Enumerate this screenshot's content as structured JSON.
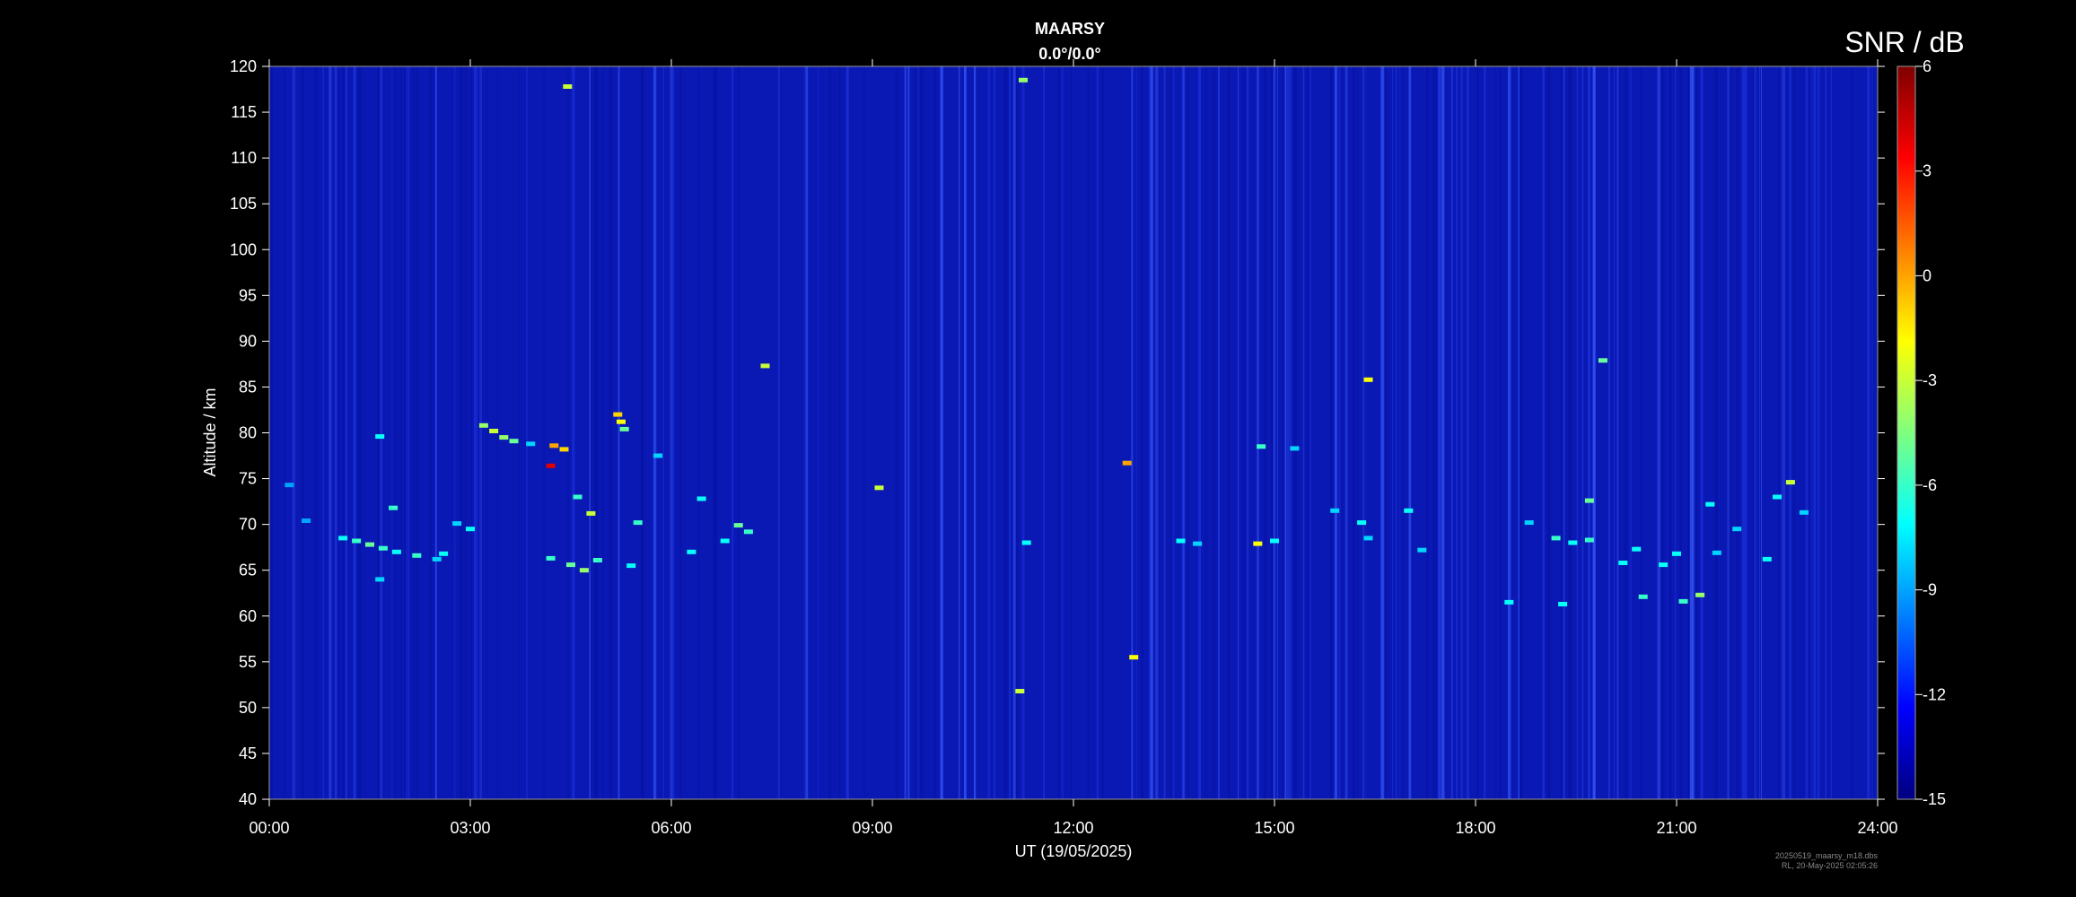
{
  "chart_data": {
    "type": "heatmap",
    "title": "MAARSY",
    "subtitle": "0.0°/0.0°",
    "xlabel": "UT (19/05/2025)",
    "ylabel": "Altitude / km",
    "x_ticks": [
      "00:00",
      "03:00",
      "06:00",
      "09:00",
      "12:00",
      "15:00",
      "18:00",
      "21:00",
      "24:00"
    ],
    "xlim_hours": [
      0,
      24
    ],
    "ylim": [
      40,
      120
    ],
    "y_ticks": [
      40,
      45,
      50,
      55,
      60,
      65,
      70,
      75,
      80,
      85,
      90,
      95,
      100,
      105,
      110,
      115,
      120
    ],
    "colorbar": {
      "title": "SNR / dB",
      "range": [
        -15,
        6
      ],
      "ticks": [
        -15,
        -12,
        -9,
        -6,
        -3,
        0,
        3,
        6
      ],
      "colormap": [
        "#00007f",
        "#0000ff",
        "#007fff",
        "#00ffff",
        "#7fff7f",
        "#ffff00",
        "#ff7f00",
        "#ff0000",
        "#7f0000"
      ]
    },
    "background_snr": -14.5,
    "echoes": [
      {
        "t": 1.1,
        "alt": 68.5,
        "snr": -7
      },
      {
        "t": 1.3,
        "alt": 68.2,
        "snr": -6
      },
      {
        "t": 1.5,
        "alt": 67.8,
        "snr": -5
      },
      {
        "t": 1.7,
        "alt": 67.4,
        "snr": -6
      },
      {
        "t": 1.9,
        "alt": 67.0,
        "snr": -7
      },
      {
        "t": 2.2,
        "alt": 66.6,
        "snr": -6
      },
      {
        "t": 2.5,
        "alt": 66.2,
        "snr": -8
      },
      {
        "t": 2.6,
        "alt": 66.8,
        "snr": -7
      },
      {
        "t": 1.85,
        "alt": 71.8,
        "snr": -6
      },
      {
        "t": 1.65,
        "alt": 64.0,
        "snr": -8
      },
      {
        "t": 1.65,
        "alt": 79.6,
        "snr": -7
      },
      {
        "t": 2.8,
        "alt": 70.1,
        "snr": -8
      },
      {
        "t": 3.0,
        "alt": 69.5,
        "snr": -7
      },
      {
        "t": 0.3,
        "alt": 74.3,
        "snr": -9
      },
      {
        "t": 0.55,
        "alt": 70.4,
        "snr": -9
      },
      {
        "t": 3.2,
        "alt": 80.8,
        "snr": -4
      },
      {
        "t": 3.35,
        "alt": 80.2,
        "snr": -3
      },
      {
        "t": 3.5,
        "alt": 79.5,
        "snr": -4
      },
      {
        "t": 3.65,
        "alt": 79.1,
        "snr": -5
      },
      {
        "t": 3.9,
        "alt": 78.8,
        "snr": -8
      },
      {
        "t": 4.25,
        "alt": 78.6,
        "snr": 0
      },
      {
        "t": 4.4,
        "alt": 78.2,
        "snr": -1
      },
      {
        "t": 4.2,
        "alt": 76.4,
        "snr": 4
      },
      {
        "t": 4.6,
        "alt": 73.0,
        "snr": -6
      },
      {
        "t": 4.8,
        "alt": 71.2,
        "snr": -3
      },
      {
        "t": 4.2,
        "alt": 66.3,
        "snr": -6
      },
      {
        "t": 4.5,
        "alt": 65.6,
        "snr": -5
      },
      {
        "t": 4.7,
        "alt": 65.0,
        "snr": -4
      },
      {
        "t": 4.9,
        "alt": 66.1,
        "snr": -6
      },
      {
        "t": 5.2,
        "alt": 82.0,
        "snr": -1
      },
      {
        "t": 5.25,
        "alt": 81.2,
        "snr": -2
      },
      {
        "t": 5.3,
        "alt": 80.4,
        "snr": -5
      },
      {
        "t": 5.5,
        "alt": 70.2,
        "snr": -6
      },
      {
        "t": 5.4,
        "alt": 65.5,
        "snr": -7
      },
      {
        "t": 5.8,
        "alt": 77.5,
        "snr": -8
      },
      {
        "t": 6.3,
        "alt": 67.0,
        "snr": -7
      },
      {
        "t": 6.45,
        "alt": 72.8,
        "snr": -7
      },
      {
        "t": 6.8,
        "alt": 68.2,
        "snr": -7
      },
      {
        "t": 7.0,
        "alt": 69.9,
        "snr": -5
      },
      {
        "t": 7.15,
        "alt": 69.2,
        "snr": -6
      },
      {
        "t": 7.4,
        "alt": 87.3,
        "snr": -3
      },
      {
        "t": 9.1,
        "alt": 74.0,
        "snr": -3
      },
      {
        "t": 11.3,
        "alt": 68.0,
        "snr": -7
      },
      {
        "t": 12.8,
        "alt": 76.7,
        "snr": 0
      },
      {
        "t": 13.6,
        "alt": 68.2,
        "snr": -7
      },
      {
        "t": 13.85,
        "alt": 67.9,
        "snr": -8
      },
      {
        "t": 14.8,
        "alt": 78.5,
        "snr": -6
      },
      {
        "t": 14.75,
        "alt": 67.9,
        "snr": -2
      },
      {
        "t": 15.0,
        "alt": 68.2,
        "snr": -7
      },
      {
        "t": 15.3,
        "alt": 78.3,
        "snr": -8
      },
      {
        "t": 15.9,
        "alt": 71.5,
        "snr": -8
      },
      {
        "t": 16.3,
        "alt": 70.2,
        "snr": -7
      },
      {
        "t": 16.4,
        "alt": 68.5,
        "snr": -8
      },
      {
        "t": 16.4,
        "alt": 85.8,
        "snr": -2
      },
      {
        "t": 17.0,
        "alt": 71.5,
        "snr": -7
      },
      {
        "t": 17.2,
        "alt": 67.2,
        "snr": -8
      },
      {
        "t": 18.5,
        "alt": 61.5,
        "snr": -7
      },
      {
        "t": 18.8,
        "alt": 70.2,
        "snr": -8
      },
      {
        "t": 19.2,
        "alt": 68.5,
        "snr": -6
      },
      {
        "t": 19.45,
        "alt": 68.0,
        "snr": -7
      },
      {
        "t": 19.7,
        "alt": 68.3,
        "snr": -6
      },
      {
        "t": 19.3,
        "alt": 61.3,
        "snr": -7
      },
      {
        "t": 19.7,
        "alt": 72.6,
        "snr": -5
      },
      {
        "t": 19.9,
        "alt": 87.9,
        "snr": -5
      },
      {
        "t": 20.2,
        "alt": 65.8,
        "snr": -7
      },
      {
        "t": 20.4,
        "alt": 67.3,
        "snr": -7
      },
      {
        "t": 20.5,
        "alt": 62.1,
        "snr": -6
      },
      {
        "t": 20.8,
        "alt": 65.6,
        "snr": -7
      },
      {
        "t": 21.0,
        "alt": 66.8,
        "snr": -7
      },
      {
        "t": 21.1,
        "alt": 61.6,
        "snr": -6
      },
      {
        "t": 21.35,
        "alt": 62.3,
        "snr": -4
      },
      {
        "t": 21.5,
        "alt": 72.2,
        "snr": -7
      },
      {
        "t": 21.6,
        "alt": 66.9,
        "snr": -8
      },
      {
        "t": 21.9,
        "alt": 69.5,
        "snr": -8
      },
      {
        "t": 22.35,
        "alt": 66.2,
        "snr": -7
      },
      {
        "t": 22.5,
        "alt": 73.0,
        "snr": -7
      },
      {
        "t": 22.7,
        "alt": 74.6,
        "snr": -3
      },
      {
        "t": 22.9,
        "alt": 71.3,
        "snr": -8
      },
      {
        "t": 4.45,
        "alt": 117.8,
        "snr": -3
      },
      {
        "t": 12.9,
        "alt": 55.5,
        "snr": -2
      },
      {
        "t": 11.2,
        "alt": 51.8,
        "snr": -3
      },
      {
        "t": 11.25,
        "alt": 118.5,
        "snr": -4
      }
    ],
    "footnote_lines": [
      "20250519_maarsy_m18.dbs",
      "RL, 20-May-2025 02:05:26"
    ]
  }
}
